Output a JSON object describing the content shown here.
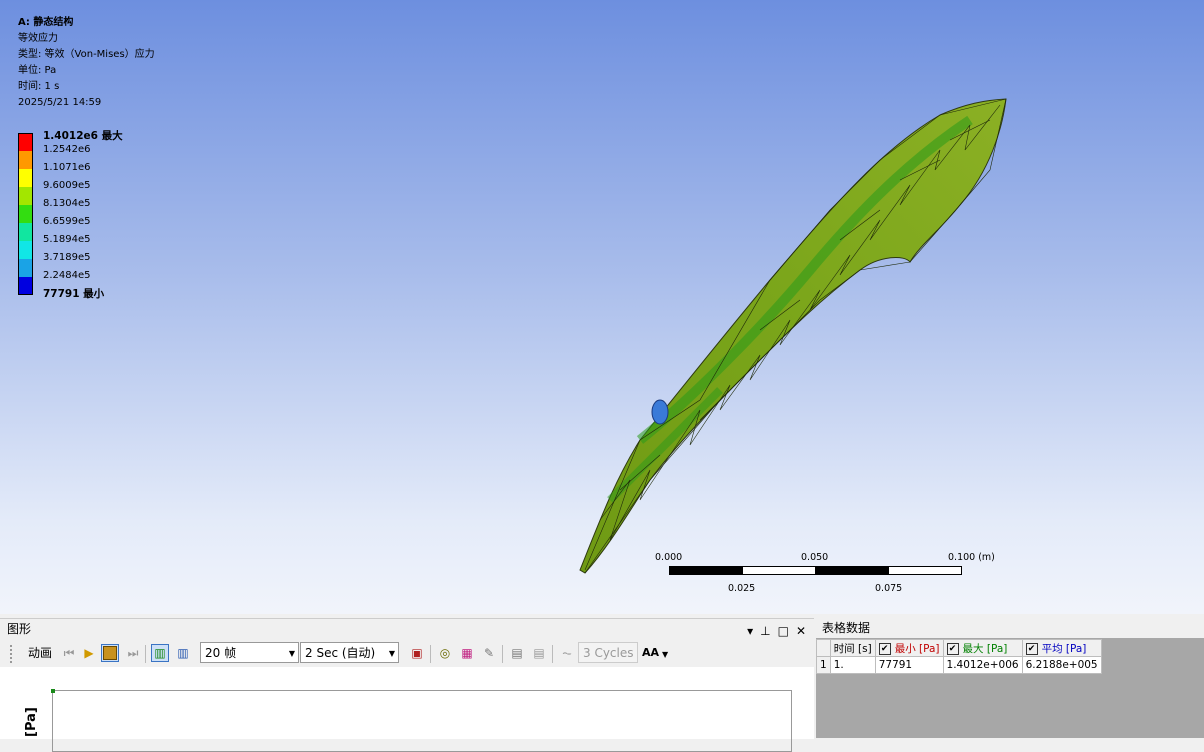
{
  "header": {
    "system": "A: 静态结构",
    "result": "等效应力",
    "type": "类型: 等效（Von-Mises）应力",
    "unit": "单位: Pa",
    "time": "时间: 1 s",
    "date": "2025/5/21 14:59"
  },
  "legend": {
    "entries": [
      {
        "label": "1.4012e6 最大",
        "color": "#ff0000"
      },
      {
        "label": "1.2542e6",
        "color": "#ff9900"
      },
      {
        "label": "1.1071e6",
        "color": "#ffff00"
      },
      {
        "label": "9.6009e5",
        "color": "#a3e600"
      },
      {
        "label": "8.1304e5",
        "color": "#33dd11"
      },
      {
        "label": "6.6599e5",
        "color": "#11e6a0"
      },
      {
        "label": "5.1894e5",
        "color": "#11e6e6"
      },
      {
        "label": "3.7189e5",
        "color": "#1aa3e6"
      },
      {
        "label": "2.2484e5",
        "color": "#1a4de6"
      },
      {
        "label": "77791 最小",
        "color": null
      }
    ]
  },
  "scale": {
    "top_labels": [
      "0.000",
      "0.050",
      "0.100 (m)"
    ],
    "bottom_labels": [
      "0.025",
      "0.075"
    ]
  },
  "graph_pane": {
    "title": "图形",
    "controls": [
      "▾",
      "⊥",
      "□",
      "✕"
    ],
    "animate_label": "动画",
    "frames": "20 帧",
    "duration": "2 Sec (自动)",
    "cycles": "3 Cycles",
    "aa_label": "AA",
    "y_axis_label": "[Pa]"
  },
  "table_pane": {
    "title": "表格数据",
    "columns": [
      "时间 [s]",
      "最小 [Pa]",
      "最大 [Pa]",
      "平均 [Pa]"
    ],
    "column_colors": [
      "#000000",
      "#c00000",
      "#008000",
      "#0000c0"
    ],
    "rows": [
      {
        "index": "1",
        "cells": [
          "1.",
          "77791",
          "1.4012e+006",
          "6.2188e+005"
        ]
      }
    ]
  }
}
